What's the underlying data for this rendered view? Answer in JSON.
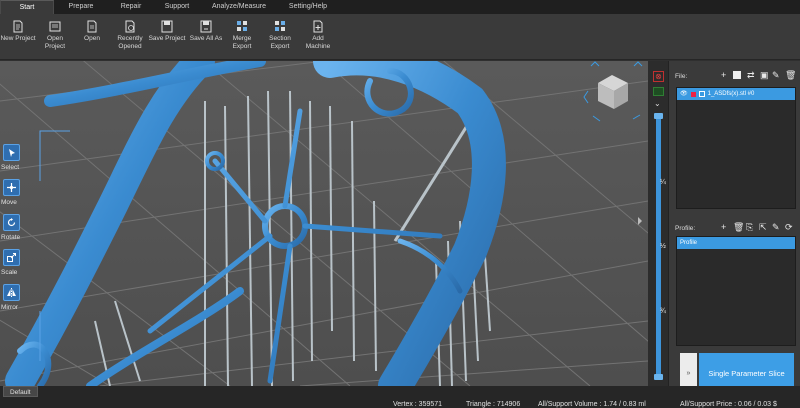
{
  "tabs": [
    "Start",
    "Prepare",
    "Repair",
    "Support",
    "Analyze/Measure",
    "Setting/Help"
  ],
  "ribbon": {
    "buttons": [
      {
        "label": "New Project",
        "icon": "new-project-icon"
      },
      {
        "label": "Open\nProject",
        "icon": "open-project-icon"
      },
      {
        "label": "Open",
        "icon": "open-icon"
      },
      {
        "label": "Recently\nOpened",
        "icon": "recent-icon"
      },
      {
        "label": "Save Project",
        "icon": "save-project-icon"
      },
      {
        "label": "Save All As",
        "icon": "save-all-icon"
      },
      {
        "label": "Merge\nExport",
        "icon": "merge-export-icon"
      },
      {
        "label": "Section\nExport",
        "icon": "section-export-icon"
      },
      {
        "label": "Add\nMachine",
        "icon": "add-machine-icon"
      }
    ]
  },
  "tools": [
    {
      "label": "Select",
      "icon": "select-icon"
    },
    {
      "label": "Move",
      "icon": "move-icon"
    },
    {
      "label": "Rotate",
      "icon": "rotate-icon"
    },
    {
      "label": "Scale",
      "icon": "scale-icon"
    },
    {
      "label": "Mirror",
      "icon": "mirror-icon"
    }
  ],
  "slider": {
    "fractions": [
      "¼",
      "½",
      "¾"
    ],
    "top_level": 1.0
  },
  "right_panel": {
    "file_title": "File:",
    "file_item": "1_ASDfs(x).stl #0",
    "profile_title": "Profile:",
    "profile_item": "Profile",
    "slice_button": "Single Parameter Slice",
    "slice_arrow": "»"
  },
  "status": {
    "default_tab": "Default",
    "vertex": "Vertex : 359571",
    "triangle": "Triangle : 714906",
    "volume": "All/Support Volume : 1.74 / 0.83 ml",
    "price": "All/Support Price : 0.06 / 0.03 $"
  },
  "colors": {
    "accent": "#3b9ae1",
    "model": "#3f8fd0",
    "support": "#b8c2c8",
    "grid": "#6f6f6f"
  }
}
